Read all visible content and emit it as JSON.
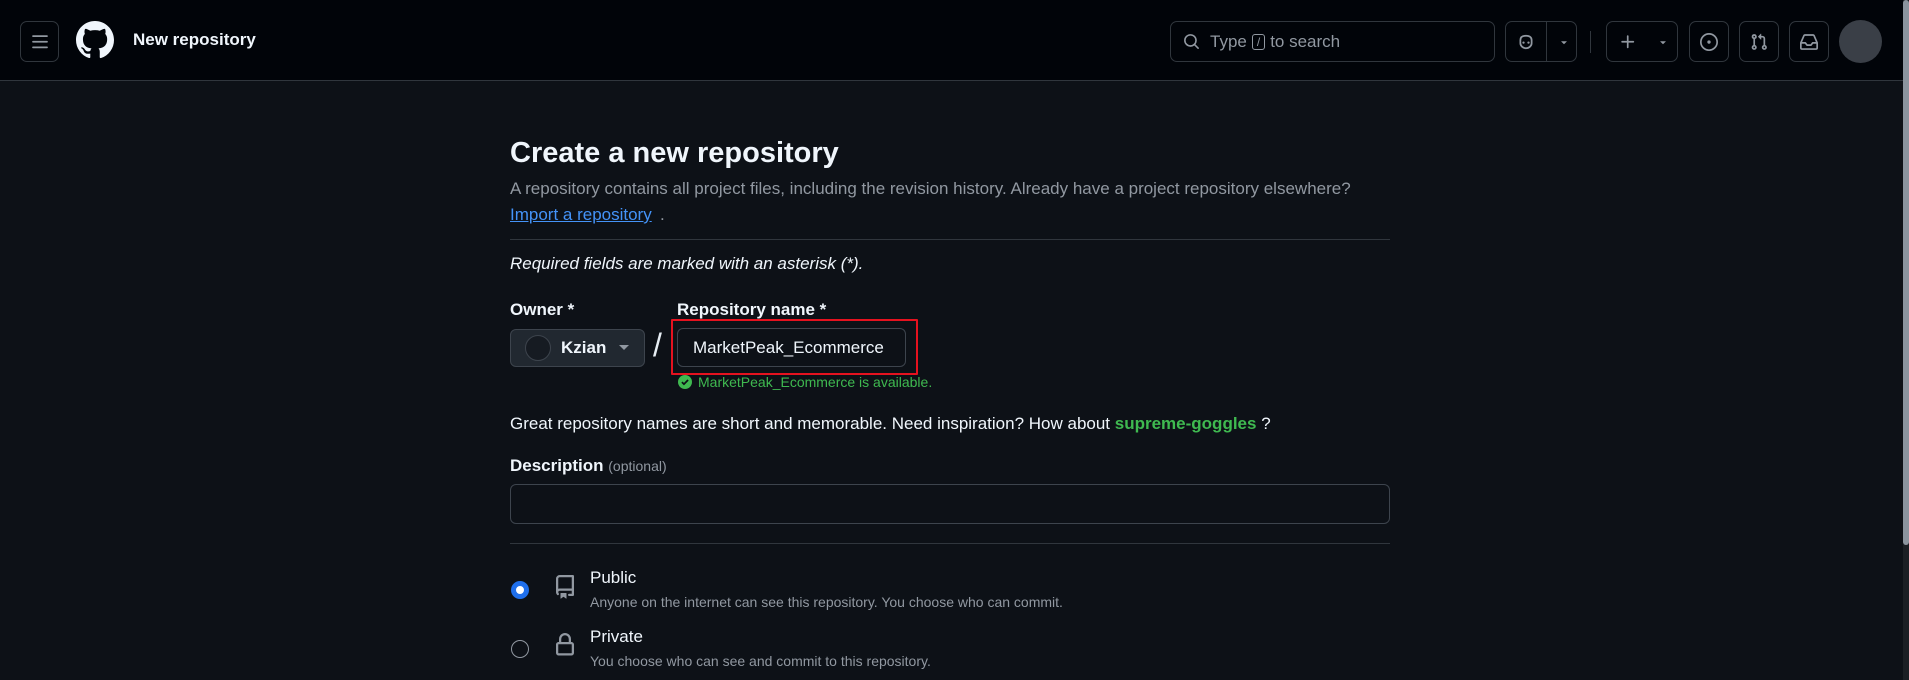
{
  "header": {
    "title": "New repository",
    "search": {
      "prefix": "Type",
      "key": "/",
      "suffix": "to search"
    },
    "icons": [
      "hamburger-menu-icon",
      "github-logo-icon",
      "search-icon",
      "copilot-icon",
      "chevron-down-icon",
      "plus-icon",
      "issues-icon",
      "pull-requests-icon",
      "inbox-icon",
      "avatar"
    ]
  },
  "main": {
    "heading": "Create a new repository",
    "intro": "A repository contains all project files, including the revision history. Already have a project repository elsewhere?",
    "import_link": "Import a repository",
    "import_suffix": ".",
    "required_note": "Required fields are marked with an asterisk (*).",
    "owner": {
      "label": "Owner *",
      "value": "Kzian"
    },
    "slash": "/",
    "repo_name": {
      "label": "Repository name *",
      "value": "MarketPeak_Ecommerce",
      "availability": "MarketPeak_Ecommerce is available."
    },
    "suggestion": {
      "prefix": "Great repository names are short and memorable. Need inspiration? How about",
      "name": "supreme-goggles",
      "suffix": "?"
    },
    "description": {
      "label": "Description",
      "optional": "(optional)",
      "value": ""
    },
    "visibility": [
      {
        "title": "Public",
        "desc": "Anyone on the internet can see this repository. You choose who can commit.",
        "checked": true
      },
      {
        "title": "Private",
        "desc": "You choose who can see and commit to this repository.",
        "checked": false
      }
    ]
  },
  "colors": {
    "background": "#0d1117",
    "header": "#010409",
    "accent": "#1f6feb",
    "link": "#4493f8",
    "success": "#3fb950",
    "highlight": "#e5121f"
  }
}
